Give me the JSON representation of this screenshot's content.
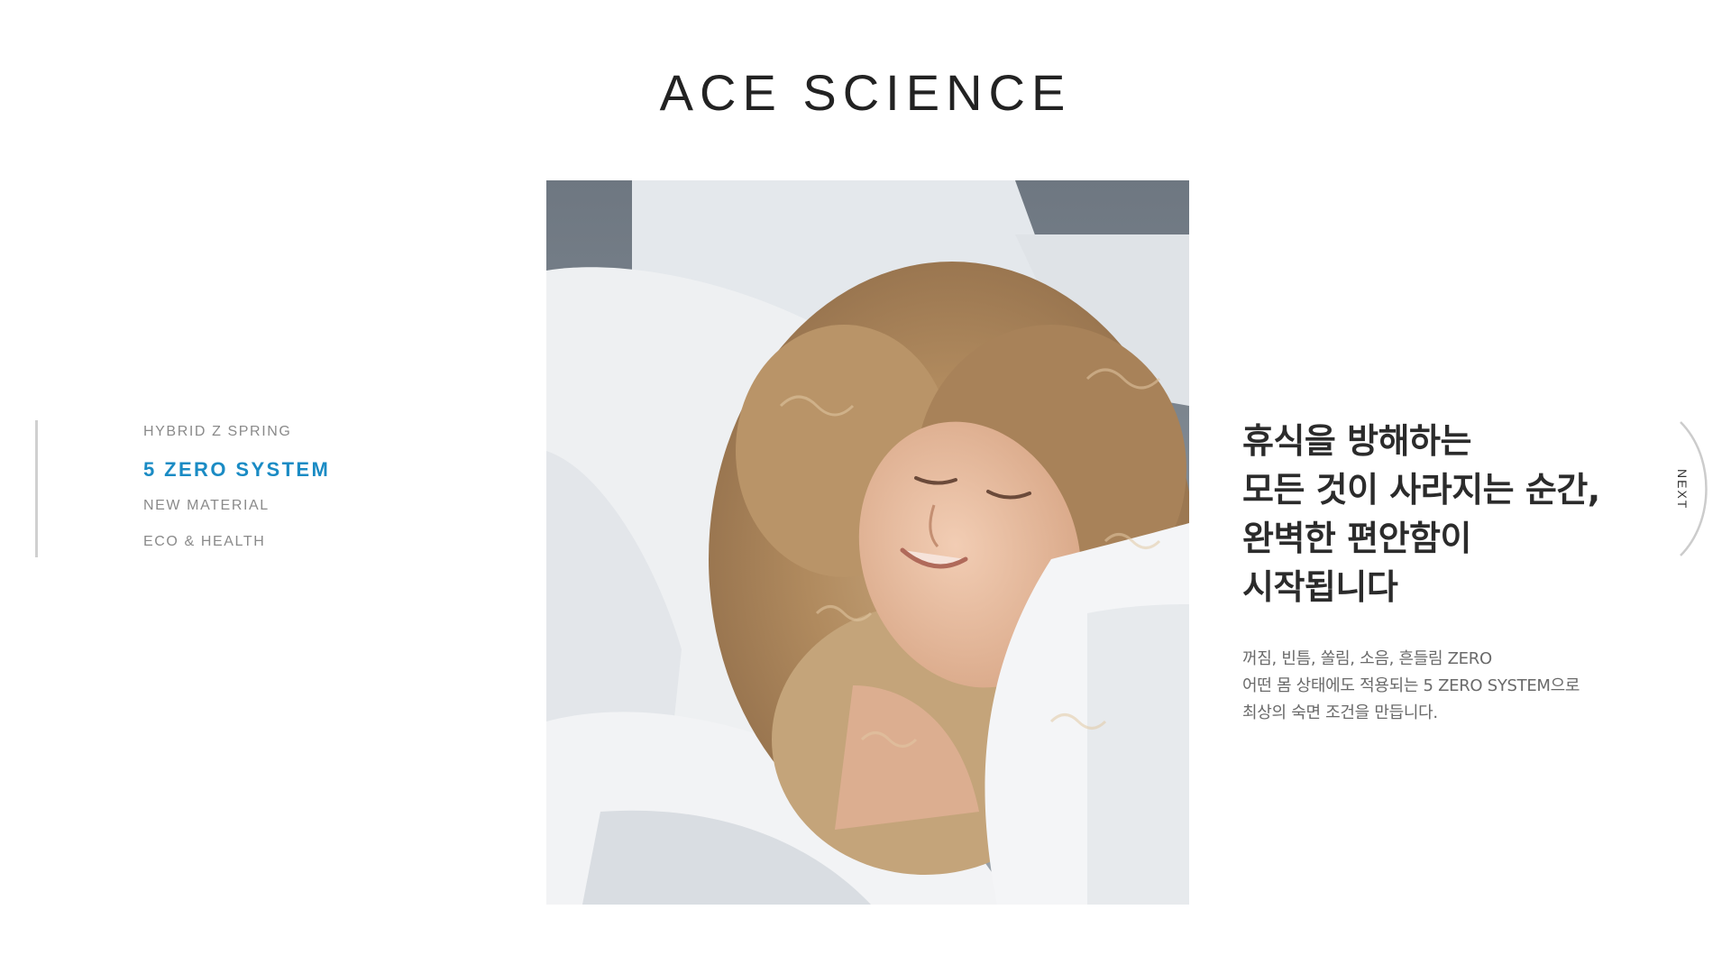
{
  "page": {
    "title": "ACE SCIENCE"
  },
  "nav": {
    "items": [
      {
        "label": "HYBRID Z SPRING",
        "active": false
      },
      {
        "label": "5 ZERO SYSTEM",
        "active": true
      },
      {
        "label": "NEW MATERIAL",
        "active": false
      },
      {
        "label": "ECO & HEALTH",
        "active": false
      }
    ]
  },
  "copy": {
    "heading_lines": [
      "휴식을 방해하는",
      "모든 것이 사라지는 순간,",
      "완벽한 편안함이",
      "시작됩니다"
    ],
    "desc_lines": [
      "꺼짐, 빈틈, 쏠림, 소음, 흔들림 ZERO",
      "어떤 몸 상태에도 적용되는 5 ZERO SYSTEM으로",
      "최상의 숙면 조건을 만듭니다."
    ]
  },
  "next": {
    "label": "NEXT"
  },
  "colors": {
    "accent": "#1a8bc4",
    "text_dark": "#2b2b2b",
    "text_muted": "#8a8a8a"
  }
}
